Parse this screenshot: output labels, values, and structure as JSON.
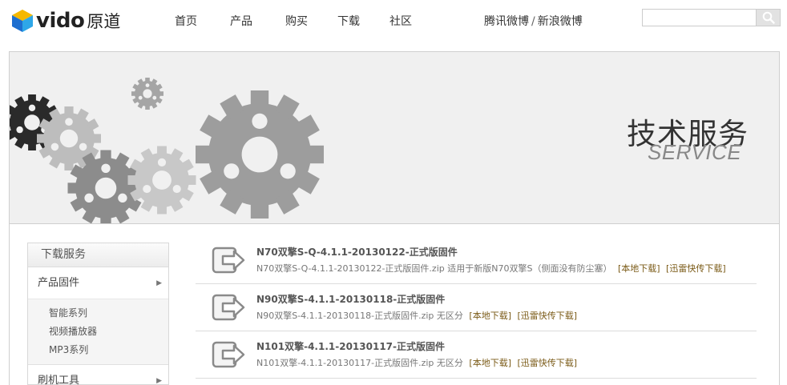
{
  "brand": {
    "name": "vido",
    "cn_name": "原道"
  },
  "nav": {
    "items": [
      {
        "label": "首页"
      },
      {
        "label": "产品"
      },
      {
        "label": "购买"
      },
      {
        "label": "下载"
      },
      {
        "label": "社区"
      }
    ]
  },
  "social": {
    "tencent": "腾讯微博",
    "separator": "/",
    "sina": "新浪微博"
  },
  "search": {
    "value": "",
    "placeholder": ""
  },
  "banner": {
    "title": "技术服务",
    "subtitle": "SERVICE"
  },
  "sidebar": {
    "heading": "下载服务",
    "sections": [
      {
        "label": "产品固件",
        "arrow": "▶",
        "subitems": [
          "智能系列",
          "视频播放器",
          "MP3系列"
        ]
      },
      {
        "label": "刷机工具",
        "arrow": "▶"
      }
    ]
  },
  "downloads": [
    {
      "title": "N70双擎S-Q-4.1.1-20130122-正式版固件",
      "desc": "N70双擎S-Q-4.1.1-20130122-正式版固件.zip 适用于新版N70双擎S（侧面没有防尘塞）",
      "local_link": "[本地下载]",
      "thunder_link": "[迅雷快传下载]"
    },
    {
      "title": "N90双擎S-4.1.1-20130118-正式版固件",
      "desc": "N90双擎S-4.1.1-20130118-正式版固件.zip 无区分",
      "local_link": "[本地下载]",
      "thunder_link": "[迅雷快传下载]"
    },
    {
      "title": "N101双擎-4.1.1-20130117-正式版固件",
      "desc": "N101双擎-4.1.1-20130117-正式版固件.zip 无区分",
      "local_link": "[本地下载]",
      "thunder_link": "[迅雷快传下载]"
    }
  ]
}
